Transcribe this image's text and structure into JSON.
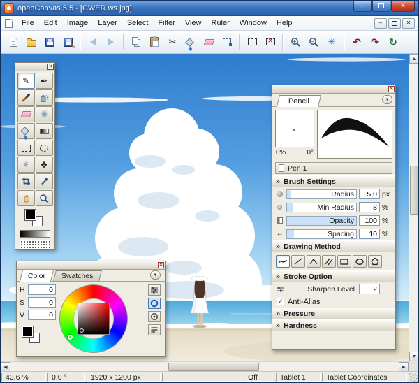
{
  "window": {
    "title": "openCanvas 5.5 - [CWER.ws.jpg]",
    "minimize_glyph": "–",
    "close_glyph": "✕"
  },
  "menu": {
    "items": [
      "File",
      "Edit",
      "Image",
      "Layer",
      "Select",
      "Filter",
      "View",
      "Ruler",
      "Window",
      "Help"
    ]
  },
  "toolbar": {
    "buttons": [
      "new-document",
      "open",
      "save",
      "save-as",
      "back",
      "forward",
      "copy",
      "paste",
      "cut",
      "fill",
      "eraser",
      "transform",
      "select-rectangle",
      "deselect",
      "zoom-in",
      "zoom-out",
      "reset-view",
      "undo",
      "redo",
      "refresh"
    ],
    "glyphs": {
      "cut": "✂",
      "reset_view": "✳",
      "undo": "↶",
      "redo": "↷",
      "refresh": "↻"
    }
  },
  "tools": {
    "names": [
      "pencil",
      "pen",
      "brush",
      "airbrush",
      "eraser",
      "blur",
      "fill",
      "gradient",
      "select-rectangle",
      "lasso",
      "magic-wand",
      "move",
      "crop",
      "eyedropper",
      "hand",
      "zoom"
    ],
    "glyphs": {
      "pencil": "✎",
      "pen": "✒",
      "magic_wand": "✳",
      "move": "✥"
    },
    "active": "pencil"
  },
  "color_panel": {
    "tabs": {
      "color": "Color",
      "swatches": "Swatches"
    },
    "active_tab": "Color",
    "dropdown_glyph": "▼",
    "fields": [
      {
        "label": "H",
        "value": "0"
      },
      {
        "label": "S",
        "value": "0"
      },
      {
        "label": "V",
        "value": "0"
      }
    ]
  },
  "brush_panel": {
    "tab": "Pencil",
    "dropdown_glyph": "▼",
    "preview_scale": "0%",
    "preview_angle": "0°",
    "preset_name": "Pen 1",
    "chevron": "»",
    "sections": {
      "brush_settings": "Brush Settings",
      "drawing_method": "Drawing Method",
      "stroke_option": "Stroke Option",
      "pressure": "Pressure",
      "hardness": "Hardness"
    },
    "params": [
      {
        "label": "Radius",
        "value": "5,0",
        "unit": "px",
        "fill": 6
      },
      {
        "label": "Min Radius",
        "value": "8",
        "unit": "%",
        "fill": 8
      },
      {
        "label": "Opacity",
        "value": "100",
        "unit": "%",
        "fill": 100
      },
      {
        "label": "Spacing",
        "value": "10",
        "unit": "%",
        "fill": 10
      }
    ],
    "spacing_icon_glyph": "↔",
    "methods": [
      "freehand",
      "line",
      "polyline",
      "hatch",
      "rectangle",
      "ellipse",
      "polygon"
    ],
    "active_method": "freehand",
    "stroke_option": {
      "sharpen_label": "Sharpen Level",
      "sharpen_value": "2",
      "anti_alias_label": "Anti-Alias",
      "anti_alias_checked": true,
      "check_glyph": "✓"
    }
  },
  "scrollbars": {
    "up": "▲",
    "down": "▼",
    "left": "◀",
    "right": "▶"
  },
  "status_bar": {
    "zoom": "43,6 %",
    "angle": "0,0 °",
    "canvas_size": "1920 x 1200 px",
    "pen_pressure": "Off",
    "tablet": "Tablet 1",
    "coordinates": "Tablet Coordinates"
  },
  "artwork": {
    "colors": {
      "sky_top": "#2e7cce",
      "sky_horizon": "#d9effb",
      "sea": "#4ea9d9",
      "sand": "#e9e2cd",
      "cloud": "#ffffff"
    }
  }
}
